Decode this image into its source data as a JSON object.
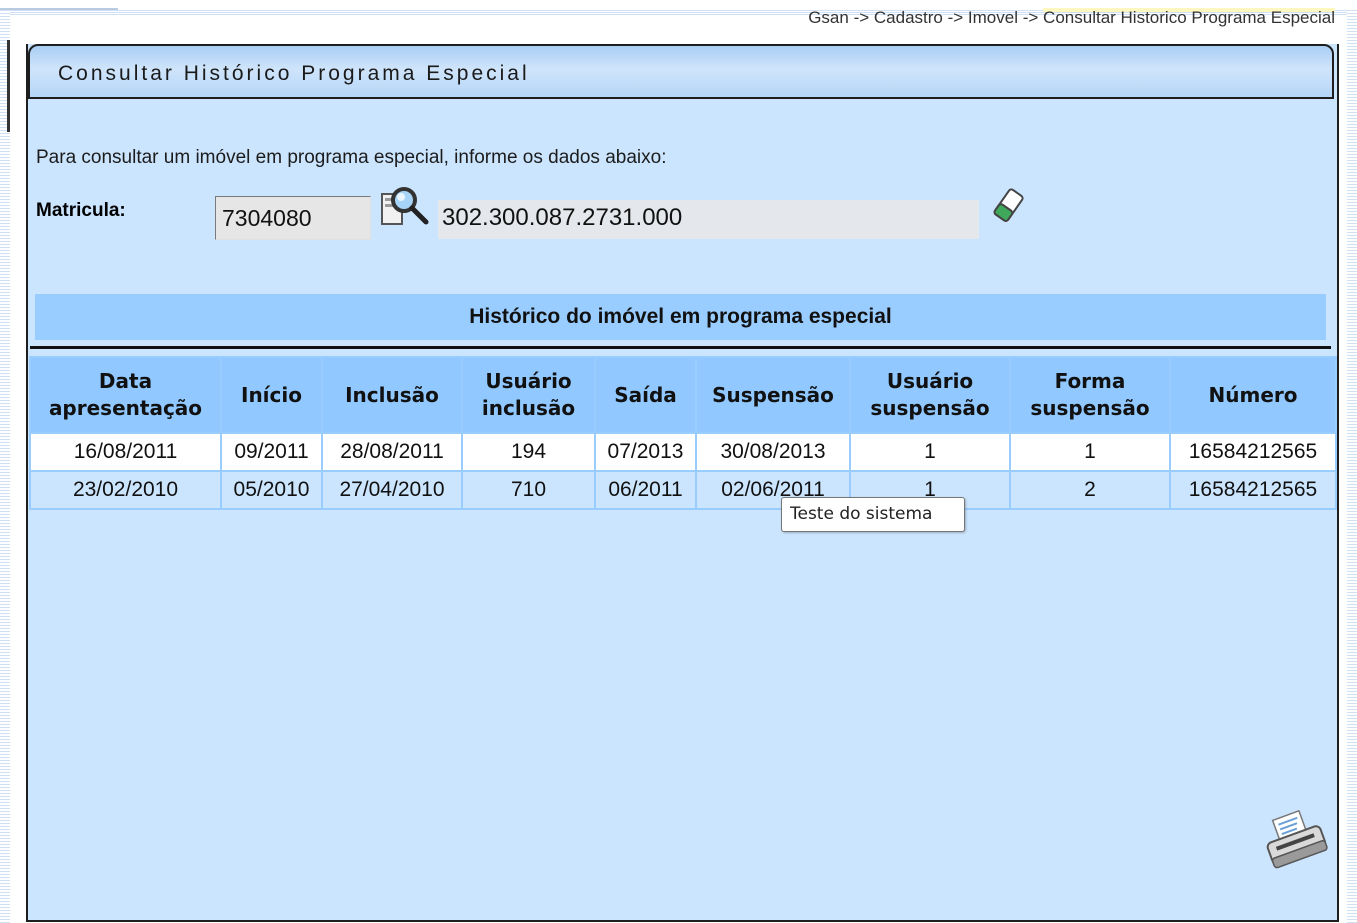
{
  "breadcrumb": {
    "root": "Gsan",
    "sep1": " -> ",
    "level1": "Cadastro",
    "sep2": " -> ",
    "level2": "Imovel",
    "sep3": " -> ",
    "current": "Consultar Historico Programa Especial"
  },
  "panel": {
    "title": "Consultar Histórico Programa Especial",
    "instructions": "Para consultar um imóvel em programa especial, informe os dados abaixo:"
  },
  "form": {
    "matricula_label": "Matricula:",
    "matricula_value": "7304080",
    "description_value": "302.300.087.2731.000"
  },
  "table": {
    "caption": "Histórico do imóvel em programa especial",
    "headers": [
      "Data apresentação",
      "Início",
      "Inclusão",
      "Usuário inclusão",
      "Saída",
      "Suspensão",
      "Usuário suspensão",
      "Forma suspensão",
      "Número"
    ],
    "rows": [
      [
        "16/08/2011",
        "09/2011",
        "28/08/2011",
        "194",
        "07/2013",
        "30/08/2013",
        "1",
        "1",
        "16584212565"
      ],
      [
        "23/02/2010",
        "05/2010",
        "27/04/2010",
        "710",
        "06/2011",
        "02/06/2011",
        "1",
        "2",
        "16584212565"
      ]
    ]
  },
  "tooltip": {
    "text": "Teste do sistema"
  },
  "icons": {
    "search": "magnifier-search-icon",
    "clear": "eraser-icon",
    "print": "printer-icon"
  },
  "colors": {
    "panel_bg": "#cce5ff",
    "header_bg": "#90c8ff",
    "caption_bg": "#99ccff"
  }
}
